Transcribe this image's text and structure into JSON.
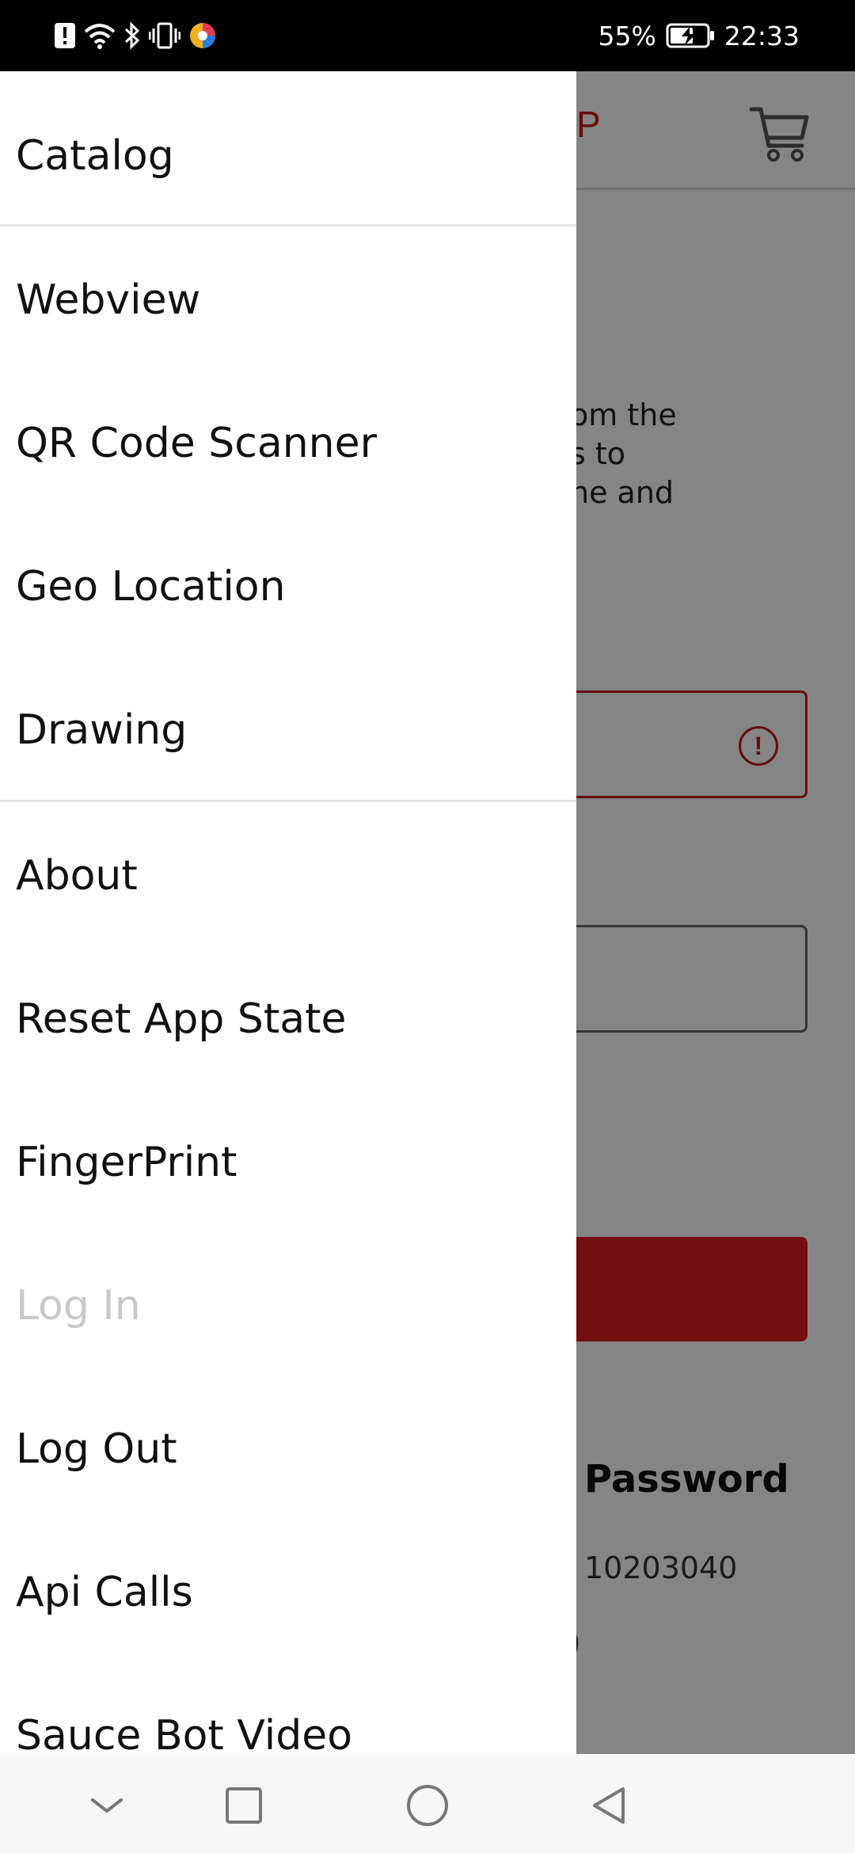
{
  "status_bar": {
    "battery": "55%",
    "time": "22:33",
    "icons": [
      "alert-icon",
      "wifi-icon",
      "bluetooth-icon",
      "vibrate-icon",
      "app-notification-icon",
      "battery-charging-icon"
    ]
  },
  "background_app": {
    "logo_fragment": "P",
    "intro_fragment": "om the\ns to\nne and",
    "password_title": "Password",
    "password_value": "10203040",
    "paren_fragment": ")",
    "colors": {
      "accent": "#e31f1f",
      "error": "#c41a1a"
    }
  },
  "drawer": {
    "items": [
      {
        "label": "Catalog"
      },
      {
        "label": "Webview"
      },
      {
        "label": "QR Code Scanner"
      },
      {
        "label": "Geo Location"
      },
      {
        "label": "Drawing"
      },
      {
        "label": "About"
      },
      {
        "label": "Reset App State"
      },
      {
        "label": "FingerPrint"
      },
      {
        "label": "Log In",
        "disabled": true
      },
      {
        "label": "Log Out"
      },
      {
        "label": "Api Calls"
      },
      {
        "label": "Sauce Bot Video"
      }
    ]
  },
  "nav_bar": {
    "buttons": [
      "collapse-icon",
      "recents-icon",
      "home-icon",
      "back-icon"
    ]
  }
}
